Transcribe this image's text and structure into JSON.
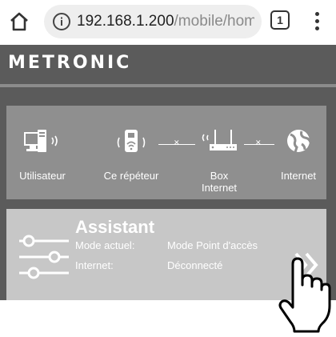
{
  "browser": {
    "home_icon": "home-icon",
    "info_icon": "info-icon",
    "url_host": "192.168.1.200",
    "url_path": "/mobile/home_n",
    "tab_count": "1",
    "menu_icon": "vertical-dots-icon"
  },
  "header": {
    "logo": "METRONIC"
  },
  "connection": {
    "devices": [
      {
        "label": "Utilisateur",
        "icon": "computer-icon"
      },
      {
        "label": "Ce répéteur",
        "icon": "repeater-icon"
      },
      {
        "label": "Box\nInternet",
        "icon": "router-icon"
      },
      {
        "label": "Internet",
        "icon": "globe-icon"
      }
    ]
  },
  "assistant": {
    "title": "Assistant",
    "mode_label": "Mode actuel:",
    "mode_value": "Mode Point d'accès",
    "internet_label": "Internet:",
    "internet_value": "Déconnecté",
    "icon": "sliders-icon",
    "next_icon": "double-chevron-right-icon"
  },
  "overlay": {
    "hand_icon": "pointing-hand-icon"
  },
  "colors": {
    "page_bg": "#5b5b5b",
    "card_dark": "#8f8f8f",
    "card_light": "#c7c7c7"
  }
}
